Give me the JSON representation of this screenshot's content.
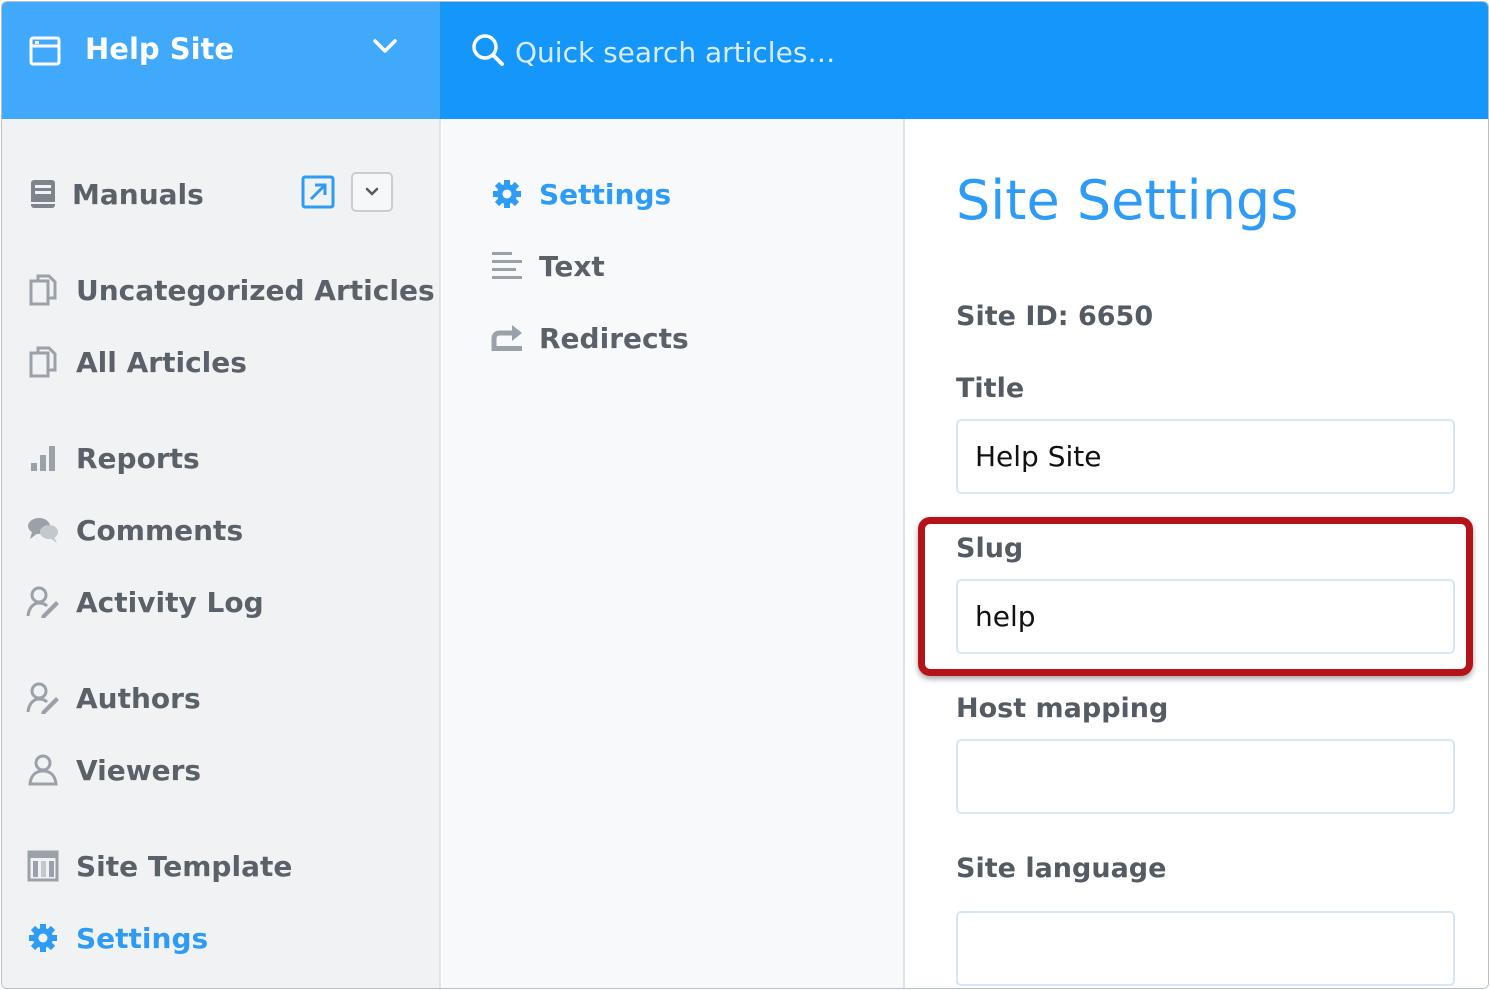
{
  "site_switcher": {
    "name": "Help Site"
  },
  "search": {
    "placeholder": "Quick search articles…"
  },
  "sidebar": {
    "manuals_label": "Manuals",
    "items": [
      {
        "label": "Uncategorized Articles",
        "icon": "documents-icon"
      },
      {
        "label": "All Articles",
        "icon": "documents-icon"
      },
      {
        "label": "Reports",
        "icon": "bar-chart-icon"
      },
      {
        "label": "Comments",
        "icon": "chat-bubbles-icon"
      },
      {
        "label": "Activity Log",
        "icon": "user-edit-icon"
      },
      {
        "label": "Authors",
        "icon": "user-edit-icon"
      },
      {
        "label": "Viewers",
        "icon": "user-icon"
      },
      {
        "label": "Site Template",
        "icon": "template-icon"
      },
      {
        "label": "Settings",
        "icon": "gear-icon",
        "active": true
      }
    ]
  },
  "subnav": {
    "items": [
      {
        "label": "Settings",
        "icon": "gear-icon",
        "active": true
      },
      {
        "label": "Text",
        "icon": "text-lines-icon"
      },
      {
        "label": "Redirects",
        "icon": "redirect-icon"
      }
    ]
  },
  "content": {
    "title": "Site Settings",
    "site_id": "Site ID: 6650",
    "fields": [
      {
        "label": "Title",
        "value": "Help Site"
      },
      {
        "label": "Slug",
        "value": "help"
      },
      {
        "label": "Host mapping",
        "value": ""
      },
      {
        "label": "Site language",
        "value": ""
      }
    ]
  },
  "colors": {
    "accent": "#2e9cf7",
    "topbar": "#1496fb",
    "site_switcher": "#40a9fb",
    "highlight": "#b51219"
  }
}
